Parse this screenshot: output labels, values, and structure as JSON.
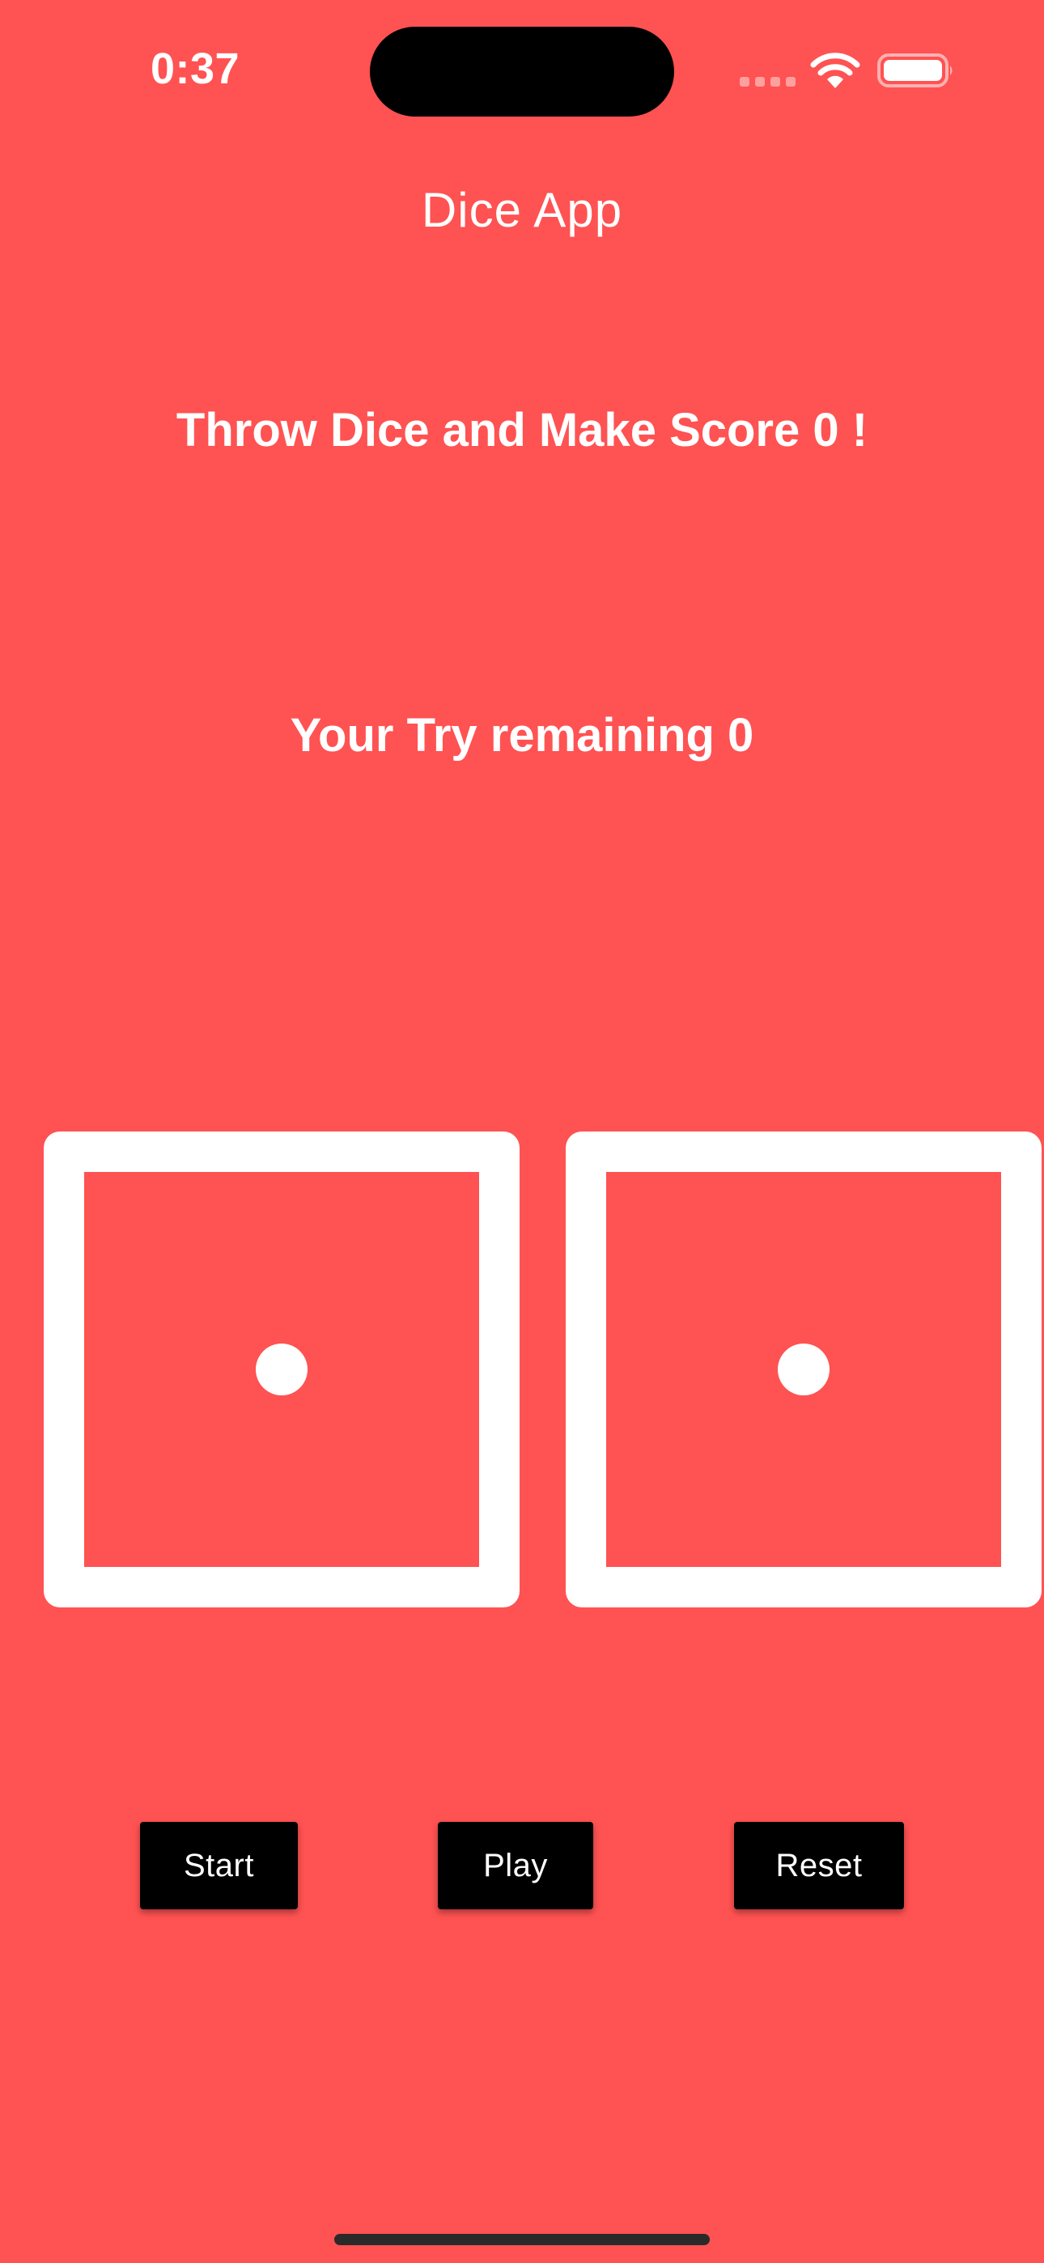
{
  "status_bar": {
    "time": "0:37",
    "icons": [
      "signal-icon",
      "wifi-icon",
      "battery-icon"
    ]
  },
  "app": {
    "title": "Dice App",
    "score_text": "Throw Dice and Make Score 0 !",
    "tries_text": "Your Try remaining 0"
  },
  "dice": [
    {
      "value": 1
    },
    {
      "value": 1
    }
  ],
  "buttons": {
    "start": "Start",
    "play": "Play",
    "reset": "Reset"
  },
  "colors": {
    "background": "#FF5252",
    "foreground": "#FFFFFF",
    "button_bg": "#000000"
  }
}
